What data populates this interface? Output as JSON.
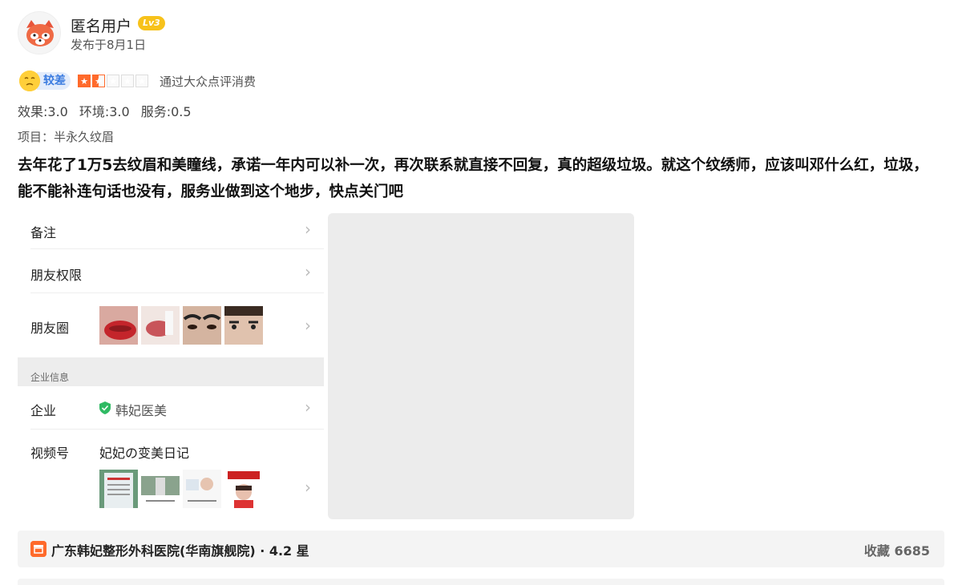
{
  "user": {
    "name": "匿名用户",
    "level": "Lv3",
    "post_time": "发布于8月1日"
  },
  "rating": {
    "label": "较差",
    "stars": 1.5,
    "max_stars": 5,
    "via": "通过大众点评消费"
  },
  "scores": {
    "effect": "效果:3.0",
    "environment": "环境:3.0",
    "service": "服务:0.5"
  },
  "project": "项目：半永久纹眉",
  "review_text": "去年花了1万5去纹眉和美瞳线，承诺一年内可以补一次，再次联系就直接不回复，真的超级垃圾。就这个纹绣师，应该叫邓什么红，垃圾，能不能补连句话也没有，服务业做到这个地步，快点关门吧",
  "wechat_profile": {
    "remark": "备注",
    "friend_permission": "朋友权限",
    "moments": "朋友圈",
    "section_title": "企业信息",
    "company_label": "企业",
    "company_name": "韩妃医美",
    "channel_label": "视频号",
    "channel_name": "妃妃の变美日记"
  },
  "shop": {
    "name": "广东韩妃整形外科医院(华南旗舰院) · 4.2 星",
    "collect": "收藏 6685"
  },
  "colors": {
    "accent_orange": "#ff6a2b",
    "badge_yellow": "#f7c21b",
    "rating_blue": "#3a7be0"
  }
}
